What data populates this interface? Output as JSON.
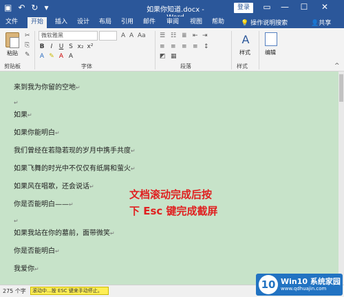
{
  "titlebar": {
    "title": "如果你知道.docx - Word",
    "login_label": "登录",
    "save_icon": "▣",
    "undo_icon": "↶",
    "redo_icon": "↻",
    "customize_icon": "▾",
    "restore_icon": "▭",
    "minimize_icon": "—",
    "maximize_icon": "☐",
    "close_icon": "✕"
  },
  "tabs": {
    "file": "文件",
    "home": "开始",
    "insert": "插入",
    "design": "设计",
    "layout": "布局",
    "references": "引用",
    "mailings": "邮件",
    "review": "审阅",
    "view": "视图",
    "help": "帮助",
    "tell_me": "操作说明搜索",
    "share": "共享"
  },
  "ribbon": {
    "paste_label": "粘贴",
    "clipboard_label": "剪贴板",
    "font_name": "微软雅黑",
    "font_size": "",
    "font_group_label": "字体",
    "paragraph_group_label": "段落",
    "styles_label": "样式",
    "styles_group_label": "样式",
    "editing_label": "编辑",
    "bold": "B",
    "italic": "I",
    "underline": "U"
  },
  "document": {
    "lines": [
      "来到我为你留的空地",
      "",
      "如果",
      "如果你能明白",
      "我们曾经在若隐若现的岁月中携手共度",
      "如果飞舞的时光中不仅仅有纸屑和萤火",
      "如果风在唱歌，还会说话",
      "你是否能明白——",
      "",
      "如果我站在你的墓前，面带微笑",
      "你是否能明白",
      "我爱你"
    ],
    "paragraph_mark": "↵",
    "overlay_line1": "文档滚动完成后按",
    "overlay_line2": "下 Esc 键完成截屏"
  },
  "statusbar": {
    "word_count": "275 个字",
    "scroll_message": "滚动中...按 ESC 键来手动停止。"
  },
  "watermark": {
    "mark": "10",
    "brand": "Win10 系统家园",
    "domain": "www.qdhuajin.com"
  }
}
